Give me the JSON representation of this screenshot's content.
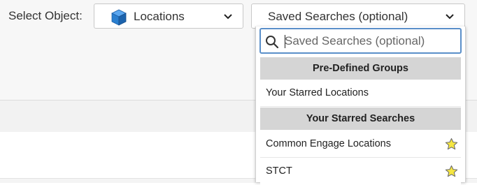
{
  "toolbar": {
    "select_label": "Select Object:",
    "object_select": {
      "value": "Locations",
      "icon": "cube-icon"
    },
    "saved_searches": {
      "value": "Saved Searches (optional)"
    }
  },
  "dropdown": {
    "search_placeholder": "Saved Searches (optional)",
    "groups": [
      {
        "header": "Pre-Defined Groups",
        "items": [
          {
            "label": "Your Starred Locations",
            "starred": false
          }
        ]
      },
      {
        "header": "Your Starred Searches",
        "items": [
          {
            "label": "Common Engage Locations",
            "starred": true
          },
          {
            "label": "STCT",
            "starred": true
          }
        ]
      }
    ]
  },
  "colors": {
    "focus_border": "#5a8fc9",
    "group_header_bg": "#d5d5d5",
    "star_fill": "#f5e642",
    "cube": "#2a7fd0"
  }
}
